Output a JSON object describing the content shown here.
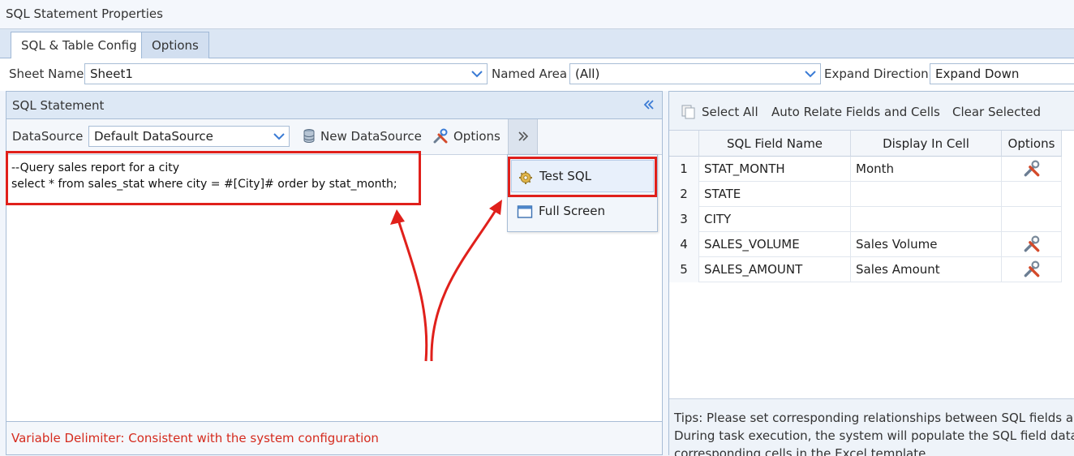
{
  "window": {
    "title": "SQL Statement Properties"
  },
  "tabs": [
    {
      "label": "SQL & Table Config",
      "active": true
    },
    {
      "label": "Options",
      "active": false
    }
  ],
  "sheet_row": {
    "sheet_name_label": "Sheet Name",
    "sheet_name_value": "Sheet1",
    "named_area_label": "Named Area",
    "named_area_value": "(All)",
    "expand_direction_label": "Expand Direction",
    "expand_direction_value": "Expand Down"
  },
  "sql_panel": {
    "title": "SQL Statement",
    "datasource_label": "DataSource",
    "datasource_value": "Default DataSource",
    "new_datasource_label": "New DataSource",
    "options_label": "Options",
    "code_lines": [
      "--Query sales report for a city",
      "select * from sales_stat where city = #[City]# order by stat_month;"
    ],
    "footer_note": "Variable Delimiter: Consistent with the system configuration"
  },
  "more_menu": {
    "items": [
      {
        "label": "Test SQL",
        "icon": "gear-icon",
        "highlighted": true
      },
      {
        "label": "Full Screen",
        "icon": "window-icon",
        "highlighted": false
      }
    ]
  },
  "field_panel": {
    "toolbar": {
      "select_all": "Select All",
      "auto_relate": "Auto Relate Fields and Cells",
      "clear_selected": "Clear Selected"
    },
    "columns": [
      "SQL Field Name",
      "Display In Cell",
      "Options"
    ],
    "rows": [
      {
        "num": "1",
        "field": "STAT_MONTH",
        "display": "Month",
        "has_option": true
      },
      {
        "num": "2",
        "field": "STATE",
        "display": "",
        "has_option": false
      },
      {
        "num": "3",
        "field": "CITY",
        "display": "",
        "has_option": false
      },
      {
        "num": "4",
        "field": "SALES_VOLUME",
        "display": "Sales Volume",
        "has_option": true
      },
      {
        "num": "5",
        "field": "SALES_AMOUNT",
        "display": "Sales Amount",
        "has_option": true
      }
    ],
    "tips_lines": [
      "Tips: Please set corresponding relationships between SQL fields and",
      "During task execution, the system will populate the SQL field data i",
      "corresponding cells in the Excel template."
    ]
  },
  "colors": {
    "accent": "#3a7bd5",
    "highlight_red": "#e0201b",
    "note_red": "#d52b1e"
  }
}
